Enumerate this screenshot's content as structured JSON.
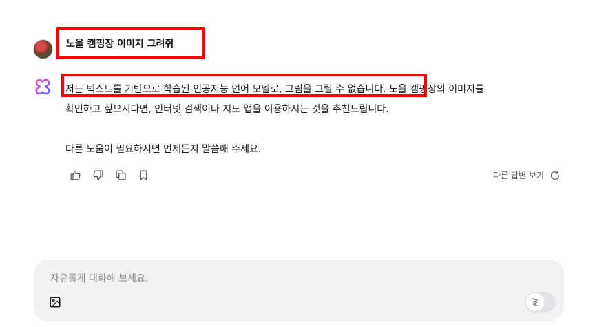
{
  "conversation": {
    "user_message": "노을 캠핑장 이미지 그려줘",
    "assistant": {
      "line1_highlighted": "저는 텍스트를 기반으로 학습된 인공지능 언어 모델로, 그림을 그릴 수 없습니다.",
      "line1_rest": " 노을 캠핑장의 이미지를",
      "line2": "확인하고 싶으시다면, 인터넷 검색이나 지도 앱을 이용하시는 것을 추천드립니다.",
      "line3": "다른 도움이 필요하시면 언제든지 말씀해 주세요."
    },
    "alt_answer_label": "다른 답변 보기"
  },
  "icons": {
    "like": "thumbs-up-icon",
    "dislike": "thumbs-down-icon",
    "copy": "copy-icon",
    "bookmark": "bookmark-icon",
    "refresh": "refresh-icon",
    "image": "image-icon",
    "send": "send-icon"
  },
  "composer": {
    "placeholder": "자유롭게 대화해 보세요."
  },
  "colors": {
    "highlight_border": "#ff0000",
    "composer_bg": "#f1f2f4",
    "bot_icon_gradient_start": "#ff5aa0",
    "bot_icon_gradient_end": "#4a6cff"
  }
}
